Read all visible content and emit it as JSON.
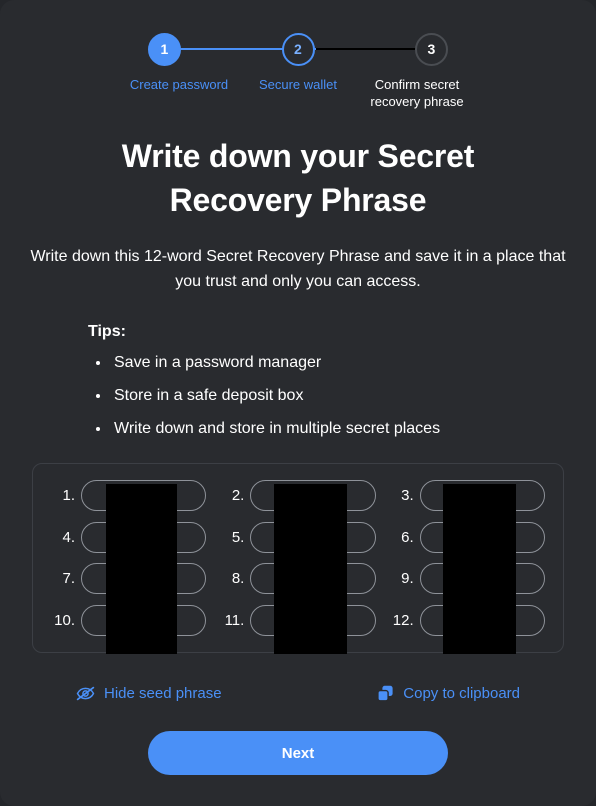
{
  "theme": {
    "page_bg": "#24262a",
    "card_bg": "#292b2f",
    "accent": "#4a90f7",
    "text": "#ffffff",
    "muted_border": "#8e9299",
    "redaction": "#000000"
  },
  "stepper": {
    "steps": [
      {
        "number": "1",
        "label": "Create password",
        "state": "complete"
      },
      {
        "number": "2",
        "label": "Secure wallet",
        "state": "active"
      },
      {
        "number": "3",
        "label": "Confirm secret recovery phrase",
        "state": "todo"
      }
    ]
  },
  "header": {
    "title": "Write down your Secret Recovery Phrase",
    "description": "Write down this 12-word Secret Recovery Phrase and save it in a place that you trust and only you can access."
  },
  "tips": {
    "heading": "Tips:",
    "items": [
      "Save in a password manager",
      "Store in a safe deposit box",
      "Write down and store in multiple secret places"
    ]
  },
  "seed_phrase": {
    "word_count": 12,
    "redacted": true,
    "cells": [
      {
        "index": "1.",
        "value": ""
      },
      {
        "index": "2.",
        "value": ""
      },
      {
        "index": "3.",
        "value": ""
      },
      {
        "index": "4.",
        "value": ""
      },
      {
        "index": "5.",
        "value": ""
      },
      {
        "index": "6.",
        "value": ""
      },
      {
        "index": "7.",
        "value": ""
      },
      {
        "index": "8.",
        "value": ""
      },
      {
        "index": "9.",
        "value": ""
      },
      {
        "index": "10.",
        "value": ""
      },
      {
        "index": "11.",
        "value": ""
      },
      {
        "index": "12.",
        "value": ""
      }
    ]
  },
  "actions": {
    "hide_label": "Hide seed phrase",
    "hide_icon": "eye-slash-icon",
    "copy_label": "Copy to clipboard",
    "copy_icon": "copy-icon"
  },
  "footer": {
    "next_label": "Next"
  }
}
